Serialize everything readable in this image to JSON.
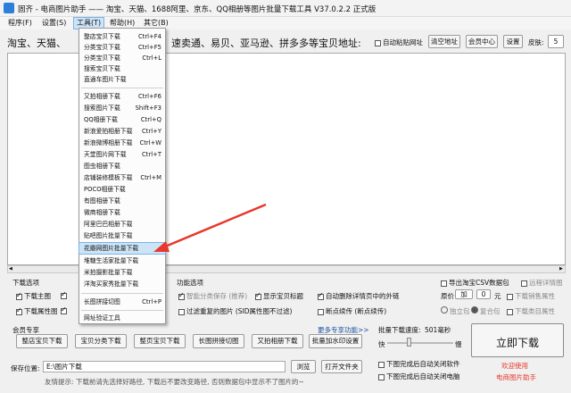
{
  "window": {
    "title": "固齐 - 电商图片助手 —— 淘宝、天猫、1688阿里、京东、QQ相册等图片批量下载工具 V37.0.2.2 正式版"
  },
  "menubar": [
    "程序(F)",
    "设置(S)",
    "工具(T)",
    "帮助(H)",
    "其它(B)"
  ],
  "toolbar": {
    "label_left": "淘宝、天猫、",
    "label_right": "速卖通、易贝、亚马逊、拼多多等宝贝地址:",
    "auto_paste": "自动粘贴网址",
    "clear_btn": "清空地址",
    "member_btn": "会员中心",
    "settings_btn": "设置",
    "skin_label": "皮肤:",
    "skin_value": "5"
  },
  "dropdown": [
    {
      "label": "整店宝贝下载",
      "shortcut": "Ctrl+F4"
    },
    {
      "label": "分类宝贝下载",
      "shortcut": "Ctrl+F5"
    },
    {
      "label": "分类宝贝下载",
      "shortcut": "Ctrl+L"
    },
    {
      "label": "搜索宝贝下载",
      "shortcut": ""
    },
    {
      "label": "直通车图片下载",
      "shortcut": ""
    },
    {
      "label": "又拍相册下载",
      "shortcut": "Ctrl+F6"
    },
    {
      "label": "搜索图片下载",
      "shortcut": "Shift+F3"
    },
    {
      "label": "QQ相册下载",
      "shortcut": "Ctrl+Q"
    },
    {
      "label": "新浪爱拍相册下载",
      "shortcut": "Ctrl+Y"
    },
    {
      "label": "新浪微博相册下载",
      "shortcut": "Ctrl+W"
    },
    {
      "label": "天堂图片网下载",
      "shortcut": "Ctrl+T"
    },
    {
      "label": "图虫相册下载",
      "shortcut": ""
    },
    {
      "label": "店铺装修模板下载",
      "shortcut": "Ctrl+M"
    },
    {
      "label": "POCO相册下载",
      "shortcut": ""
    },
    {
      "label": "有图相册下载",
      "shortcut": ""
    },
    {
      "label": "微商相册下载",
      "shortcut": ""
    },
    {
      "label": "阿里巴巴相册下载",
      "shortcut": ""
    },
    {
      "label": "贴吧图片批量下载",
      "shortcut": ""
    },
    {
      "label": "花瓣网图片批量下载",
      "shortcut": ""
    },
    {
      "label": "堆糖生活家批量下载",
      "shortcut": ""
    },
    {
      "label": "米拍摄影批量下载",
      "shortcut": ""
    },
    {
      "label": "洋淘买家秀批量下载",
      "shortcut": ""
    },
    {
      "label": "长图拼接切图",
      "shortcut": "Ctrl+P"
    },
    {
      "label": "网址验证工具",
      "shortcut": ""
    }
  ],
  "download_options": {
    "title": "下载选项",
    "main": "下载主图",
    "attr": "下载属性图",
    "col2a": "属性",
    "col2b": "属性"
  },
  "function_options": {
    "title": "功能选项",
    "smart_cat": "智能分类保存 (推荐)",
    "filter_dup": "过滤重复的图片 (SID属性图不过滤)",
    "show_title": "显示宝贝标题",
    "del_link": "自动删除详情页中的外链",
    "resume": "断点续传 (断点续传)",
    "more_link": "更多专享功能>>"
  },
  "right_options": {
    "export_csv": "导出淘宝CSV数据包",
    "remote_img": "远程详情图",
    "price_label": "原价",
    "op": "加",
    "price_val": "0",
    "unit": "元",
    "sales_attr": "下载销售属性",
    "standalone": "独立包",
    "composite": "复合包",
    "category_attr": "下载类目属性"
  },
  "member": {
    "title": "会员专享",
    "buttons": [
      "整店宝贝下载",
      "宝贝分类下载",
      "整页宝贝下载",
      "长图拼接切图",
      "又拍相册下载",
      "批量加水印设置"
    ]
  },
  "speed": {
    "title": "批量下载速度:",
    "value": "501毫秒",
    "slow": "快",
    "fast": "慢"
  },
  "after": {
    "shutdown_app": "下图完成后自动关闭软件",
    "shutdown_pc": "下图完成后自动关闭电脑"
  },
  "start": {
    "label": "立即下载",
    "welcome1": "欢迎使用",
    "welcome2": "电商图片助手"
  },
  "save": {
    "label": "保存位置:",
    "path": "E:\\图片下载",
    "browse": "浏览",
    "open": "打开文件夹",
    "hint": "友情提示: 下载前请先选择好路径, 下载后不要改变路径, 否则数据包中显示不了图片的~"
  },
  "colors": {
    "highlight": "#cde4f7",
    "arrow": "#e8372b",
    "welcome": "#e8372b"
  }
}
